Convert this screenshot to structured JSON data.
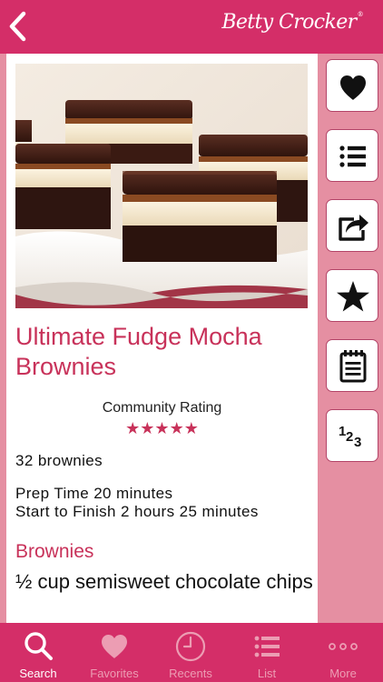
{
  "brand": {
    "name": "Betty Crocker",
    "registered_mark": "®"
  },
  "recipe": {
    "title": "Ultimate Fudge Mocha Brownies",
    "rating_label": "Community Rating",
    "rating_value": 5,
    "rating_max": 5,
    "rating_stars": "★★★★★",
    "yield": "32 brownies",
    "prep_time": "Prep Time 20 minutes",
    "start_to_finish": "Start to Finish 2 hours 25 minutes",
    "section_heading": "Brownies",
    "ingredient_1": "½ cup semisweet chocolate chips"
  },
  "sidebar": {
    "buttons": [
      {
        "icon": "heart-icon"
      },
      {
        "icon": "list-icon"
      },
      {
        "icon": "share-icon"
      },
      {
        "icon": "star-icon"
      },
      {
        "icon": "notepad-icon"
      },
      {
        "icon": "numbers-123-icon"
      }
    ]
  },
  "tabs": {
    "search": "Search",
    "favorites": "Favorites",
    "recents": "Recents",
    "list": "List",
    "more": "More",
    "active": "search"
  },
  "colors": {
    "brand_pink": "#d42e68",
    "background_pink": "#e58fa2",
    "title_red": "#c8325a",
    "inactive_tab": "#ec9db3"
  }
}
